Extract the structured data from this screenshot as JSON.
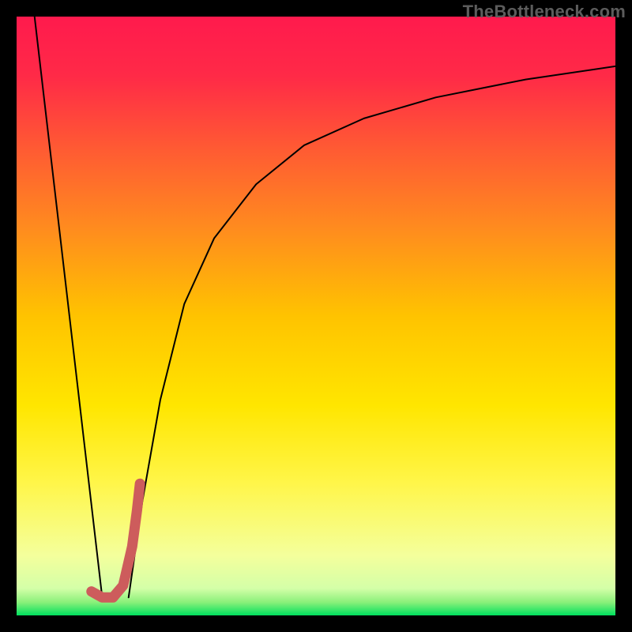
{
  "watermark": "TheBottleneck.com",
  "gradient_stops": [
    {
      "offset": 0.0,
      "color": "#ff1a4d"
    },
    {
      "offset": 0.1,
      "color": "#ff2a47"
    },
    {
      "offset": 0.22,
      "color": "#ff5a33"
    },
    {
      "offset": 0.35,
      "color": "#ff8a1f"
    },
    {
      "offset": 0.5,
      "color": "#ffc300"
    },
    {
      "offset": 0.65,
      "color": "#ffe600"
    },
    {
      "offset": 0.78,
      "color": "#fff64a"
    },
    {
      "offset": 0.9,
      "color": "#f4ff9c"
    },
    {
      "offset": 0.955,
      "color": "#d4ffa8"
    },
    {
      "offset": 0.978,
      "color": "#8af07a"
    },
    {
      "offset": 1.0,
      "color": "#00e05e"
    }
  ],
  "chart_data": {
    "type": "line",
    "title": "",
    "xlabel": "",
    "ylabel": "",
    "xlim": [
      0,
      100
    ],
    "ylim": [
      0,
      100
    ],
    "series": [
      {
        "name": "left-falling-line",
        "x": [
          3,
          14.3
        ],
        "y": [
          100,
          3
        ],
        "stroke": "#000000",
        "width": 2
      },
      {
        "name": "rising-curve",
        "x": [
          18.7,
          21,
          24,
          28,
          33,
          40,
          48,
          58,
          70,
          85,
          100
        ],
        "y": [
          3,
          19,
          36,
          52,
          63,
          72,
          78.5,
          83,
          86.5,
          89.5,
          91.7
        ],
        "stroke": "#000000",
        "width": 2
      },
      {
        "name": "pink-hook",
        "x": [
          12.5,
          14.3,
          16.1,
          17.8,
          19.3,
          20.1,
          20.6
        ],
        "y": [
          4.0,
          3.0,
          3.0,
          5.0,
          11.5,
          17.5,
          22.0
        ],
        "stroke": "#cd5c5c",
        "width": 13
      }
    ]
  }
}
